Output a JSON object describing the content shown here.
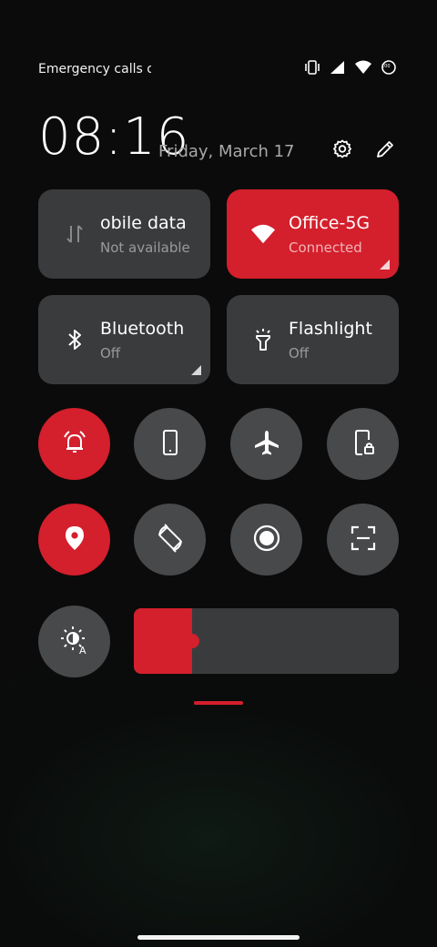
{
  "status_bar": {
    "carrier_text": "Emergency calls o",
    "icons": [
      "vibrate-icon",
      "signal-icon",
      "wifi-icon",
      "battery-icon"
    ],
    "battery_level": "100"
  },
  "header": {
    "time": "08:16",
    "date": "Friday, March 17",
    "icons": [
      "settings-icon",
      "edit-icon"
    ]
  },
  "tiles": [
    {
      "label": "obile data",
      "sub": "Not available",
      "active": false,
      "icon": "mobile-data-icon"
    },
    {
      "label": "Office-5G",
      "sub": "Connected",
      "active": true,
      "icon": "wifi-icon"
    },
    {
      "label": "Bluetooth",
      "sub": "Off",
      "active": false,
      "icon": "bluetooth-icon"
    },
    {
      "label": "Flashlight",
      "sub": "Off",
      "active": false,
      "icon": "flashlight-icon"
    }
  ],
  "toggles": [
    {
      "icon": "ring-alarm-icon",
      "active": true
    },
    {
      "icon": "phone-portrait-icon",
      "active": false
    },
    {
      "icon": "airplane-icon",
      "active": false
    },
    {
      "icon": "rotation-lock-icon",
      "active": false
    },
    {
      "icon": "location-icon",
      "active": true
    },
    {
      "icon": "auto-rotate-icon",
      "active": false
    },
    {
      "icon": "screen-record-icon",
      "active": false
    },
    {
      "icon": "screenshot-icon",
      "active": false
    }
  ],
  "brightness": {
    "icon": "auto-brightness-icon",
    "level": 0.22
  },
  "colors": {
    "accent": "#d41f2c",
    "tile_inactive": "#3a3b3d",
    "round_inactive": "#48494b"
  }
}
